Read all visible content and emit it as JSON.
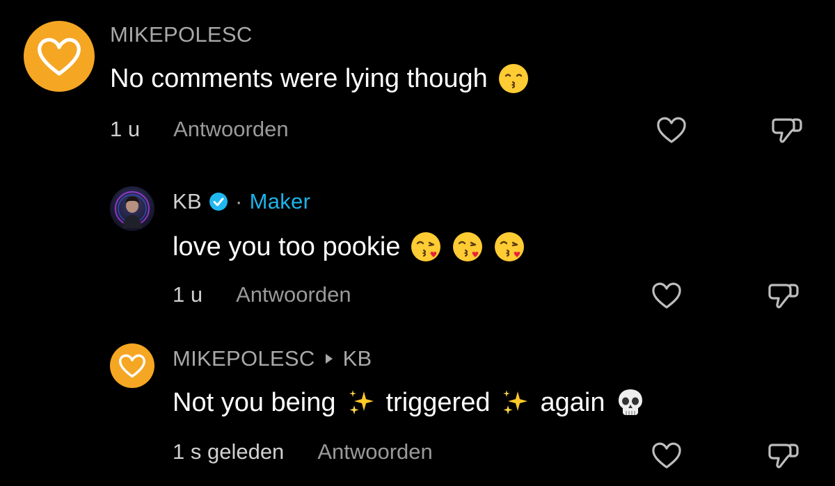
{
  "comments": [
    {
      "username": "MIKEPOLESC",
      "text": "No comments were lying though",
      "emoji": "kissing-face-smiling-eyes",
      "time": "1 u",
      "reply_label": "Antwoorden"
    },
    {
      "username": "KB",
      "verified": true,
      "separator": "·",
      "badge": "Maker",
      "text": "love you too pookie",
      "emoji": "face-blowing-kiss",
      "time": "1 u",
      "reply_label": "Antwoorden"
    },
    {
      "username": "MIKEPOLESC",
      "reply_to": "KB",
      "text_parts": [
        "Not you being",
        "triggered",
        "again"
      ],
      "emojis": [
        "sparkles",
        "sparkles",
        "skull"
      ],
      "time": "1 s geleden",
      "reply_label": "Antwoorden"
    }
  ],
  "colors": {
    "background": "#000000",
    "avatar_orange": "#f5a623",
    "maker_blue": "#1eb3e8",
    "muted": "#9a9a9a"
  }
}
